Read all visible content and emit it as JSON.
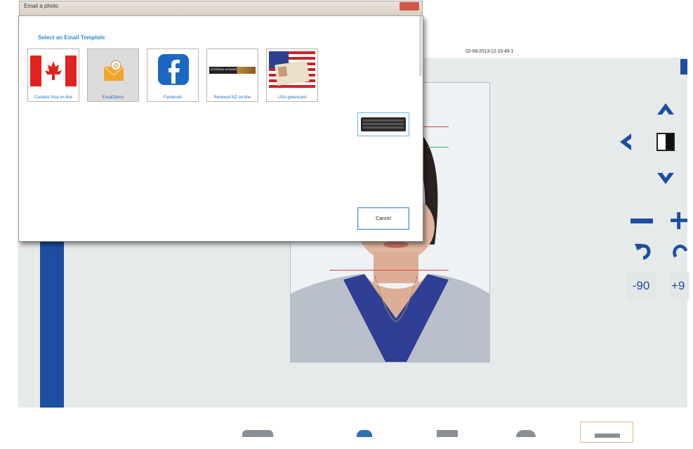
{
  "dialog": {
    "title": "Email a photo",
    "heading": "Select an Email Template",
    "templates": [
      {
        "label": "Canada Visa on-line",
        "icon": "canada-flag-icon"
      },
      {
        "label": "EmailDemo",
        "icon": "email-envelope-icon"
      },
      {
        "label": "Facebook",
        "icon": "facebook-icon"
      },
      {
        "label": "Renewal NZ on-line",
        "icon": "internal-affairs-banner-icon",
        "banner_text": "INTERNAL AFFAIRS"
      },
      {
        "label": "USA greencard",
        "icon": "usa-greencard-icon"
      }
    ],
    "keyboard_icon": "keyboard-icon",
    "cancel_label": "Cancel"
  },
  "main": {
    "timestamp": "02-08-2013-12-15-49-1",
    "controls": {
      "minus90_label": "-90",
      "plus90_label": "+9"
    }
  },
  "colors": {
    "accent": "#1c4f9f",
    "link": "#2d8bd3",
    "guide_red": "#e4423b",
    "guide_green": "#37b04a"
  }
}
